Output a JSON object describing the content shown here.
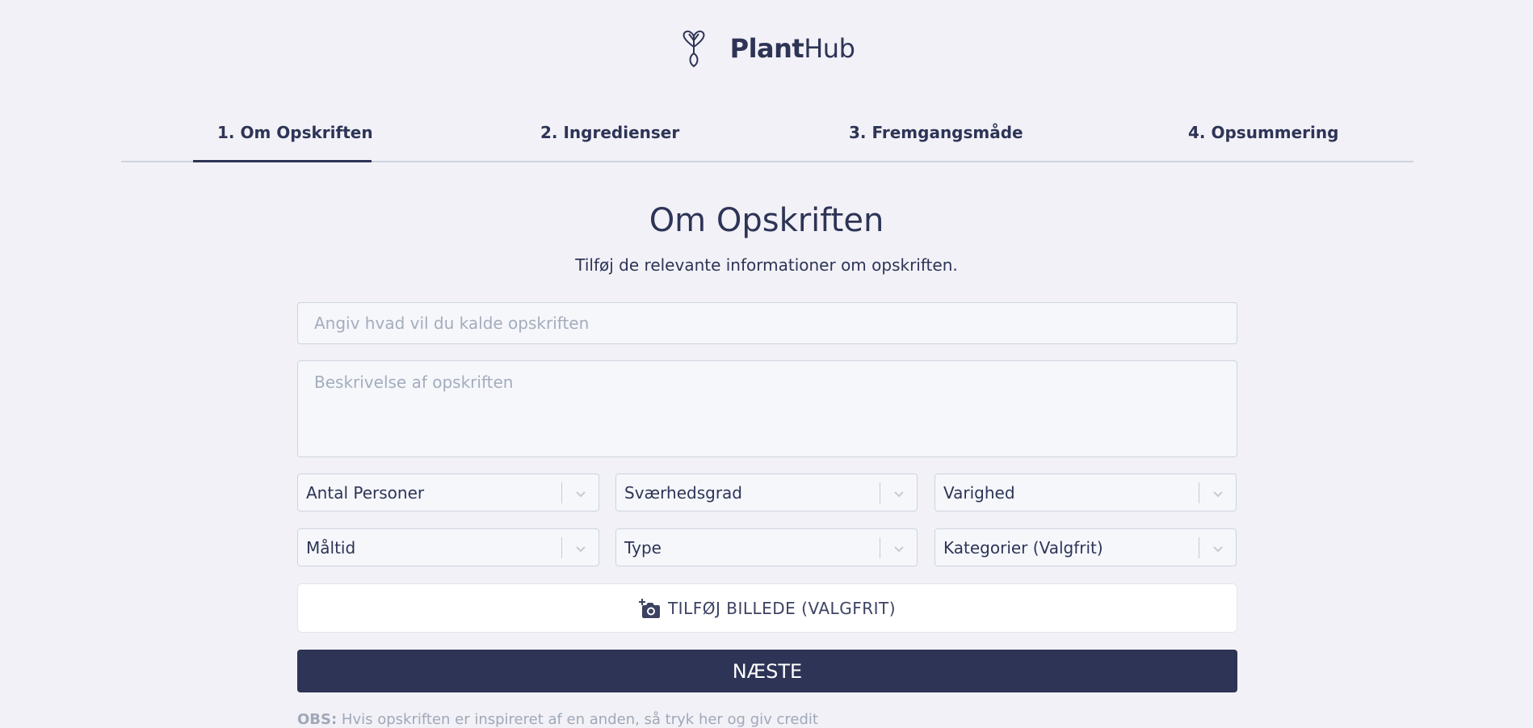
{
  "brand": {
    "bold": "Plant",
    "regular": "Hub",
    "icon": "plant-heart-logo-icon"
  },
  "tabs": [
    {
      "label": "1. Om Opskriften",
      "active": true
    },
    {
      "label": "2. Ingredienser",
      "active": false
    },
    {
      "label": "3. Fremgangsmåde",
      "active": false
    },
    {
      "label": "4. Opsummering",
      "active": false
    }
  ],
  "page": {
    "title": "Om Opskriften",
    "subtitle": "Tilføj de relevante informationer om opskriften."
  },
  "form": {
    "name_placeholder": "Angiv hvad vil du kalde opskriften",
    "name_value": "",
    "description_placeholder": "Beskrivelse af opskriften",
    "description_value": "",
    "selects": [
      "Antal Personer",
      "Sværhedsgrad",
      "Varighed",
      "Måltid",
      "Type",
      "Kategorier (Valgfrit)"
    ],
    "image_button": "TILFØJ BILLEDE (VALGFRIT)",
    "image_icon": "add-photo-icon",
    "next_button": "NÆSTE"
  },
  "note": {
    "prefix": "OBS:",
    "text": " Hvis opskriften er inspireret af en anden, så tryk her og giv credit"
  },
  "colors": {
    "background": "#f2f1f7",
    "primary": "#2d3456",
    "field_background": "#f5f7fb",
    "border": "#ced4df",
    "placeholder": "#a4adbc"
  }
}
